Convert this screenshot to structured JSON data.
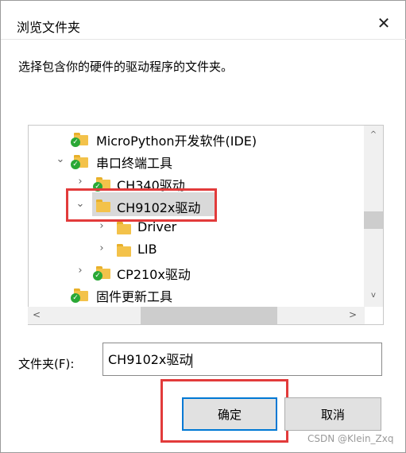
{
  "dialog": {
    "title": "浏览文件夹",
    "close_glyph": "✕",
    "instruction": "选择包含你的硬件的驱动程序的文件夹。"
  },
  "tree": {
    "items": [
      {
        "label": "MicroPython开发软件(IDE)",
        "chevron": "",
        "icon": "folder-check-icon"
      },
      {
        "label": "串口终端工具",
        "chevron": "⌄",
        "icon": "folder-check-icon"
      },
      {
        "label": "CH340驱动",
        "chevron": "›",
        "icon": "folder-check-icon"
      },
      {
        "label": "CH9102x驱动",
        "chevron": "⌄",
        "icon": "folder-icon",
        "selected": true
      },
      {
        "label": "Driver",
        "chevron": "›",
        "icon": "folder-icon"
      },
      {
        "label": "LIB",
        "chevron": "›",
        "icon": "folder-icon"
      },
      {
        "label": "CP210x驱动",
        "chevron": "›",
        "icon": "folder-check-icon"
      },
      {
        "label": "固件更新工具",
        "chevron": "",
        "icon": "folder-check-icon"
      }
    ],
    "scroll_up": "^",
    "scroll_down": "v",
    "scroll_left": "<",
    "scroll_right": ">"
  },
  "folder": {
    "label": "文件夹(F):",
    "value": "CH9102x驱动"
  },
  "buttons": {
    "ok": "确定",
    "cancel": "取消"
  },
  "watermark": "CSDN @Klein_Zxq",
  "colors": {
    "highlight_box": "#e23b3b",
    "selection": "#d9d9d9",
    "folder": "#f3c24a",
    "check": "#2aa836",
    "focus": "#0078d4"
  }
}
